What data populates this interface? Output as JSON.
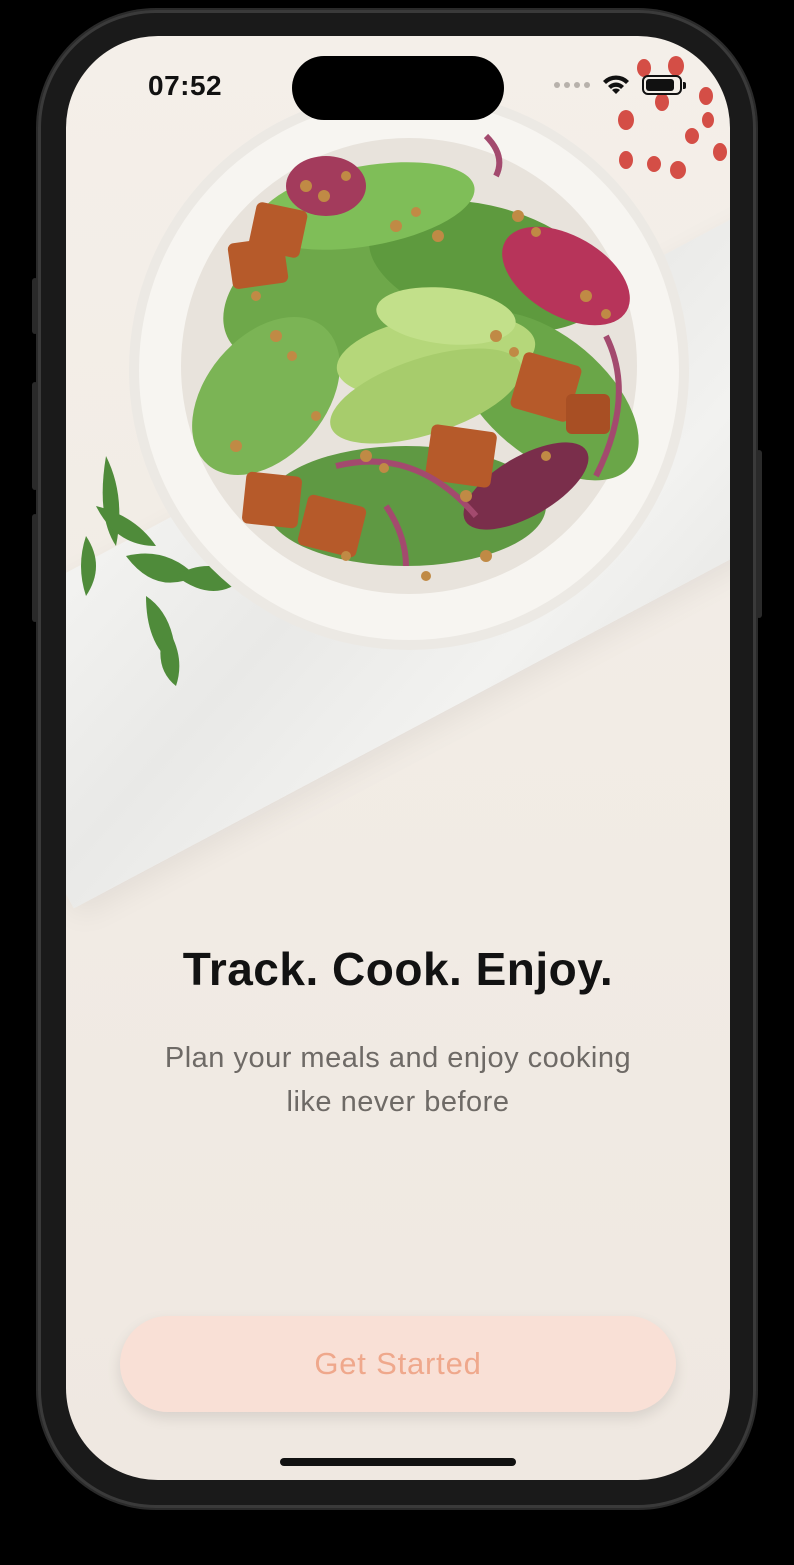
{
  "status_bar": {
    "time": "07:52",
    "wifi_icon": "wifi-icon",
    "battery_icon": "battery-icon"
  },
  "hero": {
    "image_subject": "salad-bowl-on-marble"
  },
  "onboarding": {
    "headline": "Track. Cook. Enjoy.",
    "subtitle": "Plan your meals and enjoy cooking like never before",
    "cta_label": "Get Started"
  },
  "colors": {
    "background": "#f3eee8",
    "headline": "#121212",
    "subtitle": "#6e6a66",
    "cta_background": "#f9e0d6",
    "cta_text": "#efa88c"
  }
}
